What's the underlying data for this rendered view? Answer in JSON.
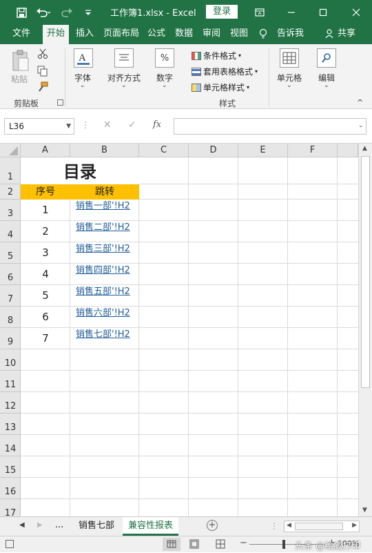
{
  "titlebar": {
    "title": "工作簿1.xlsx  -  Excel",
    "login_label": "登录",
    "bg_color": "#217346"
  },
  "menu": {
    "items": [
      "文件",
      "开始",
      "插入",
      "页面布局",
      "公式",
      "数据",
      "审阅",
      "视图"
    ],
    "tell_me": "告诉我",
    "share": "共享"
  },
  "ribbon": {
    "paste_label": "粘贴",
    "clipboard_label": "剪贴板",
    "font_label": "字体",
    "align_label": "对齐方式",
    "number_label": "数字",
    "conditional_format": "条件格式",
    "table_format": "套用表格格式",
    "cell_style": "单元格样式",
    "styles_label": "样式",
    "cells_label": "单元格",
    "edit_label": "编辑"
  },
  "formula_bar": {
    "name_box": "L36",
    "fx_symbol": "fx",
    "content": ""
  },
  "sheet": {
    "columns": [
      "A",
      "B",
      "C",
      "D",
      "E",
      "F"
    ],
    "rows": [
      "1",
      "2",
      "3",
      "4",
      "5",
      "6",
      "7",
      "8",
      "9",
      "10",
      "11",
      "12",
      "13",
      "14",
      "15",
      "16",
      "17"
    ],
    "title": "目录",
    "header_no": "序号",
    "header_jump": "跳转",
    "header_color": "#ffc000",
    "link_color": "#1f5c99",
    "entries": [
      {
        "no": "1",
        "link": "销售一部'!H2"
      },
      {
        "no": "2",
        "link": "销售二部'!H2"
      },
      {
        "no": "3",
        "link": "销售三部'!H2"
      },
      {
        "no": "4",
        "link": "销售四部'!H2"
      },
      {
        "no": "5",
        "link": "销售五部'!H2"
      },
      {
        "no": "6",
        "link": "销售六部'!H2"
      },
      {
        "no": "7",
        "link": "销售七部'!H2"
      }
    ]
  },
  "tabs": {
    "ellipsis": "...",
    "sheet1": "销售七部",
    "sheet2": "兼容性报表"
  },
  "status": {
    "zoom": "100%",
    "watermark": "头条 @绘威打印"
  }
}
